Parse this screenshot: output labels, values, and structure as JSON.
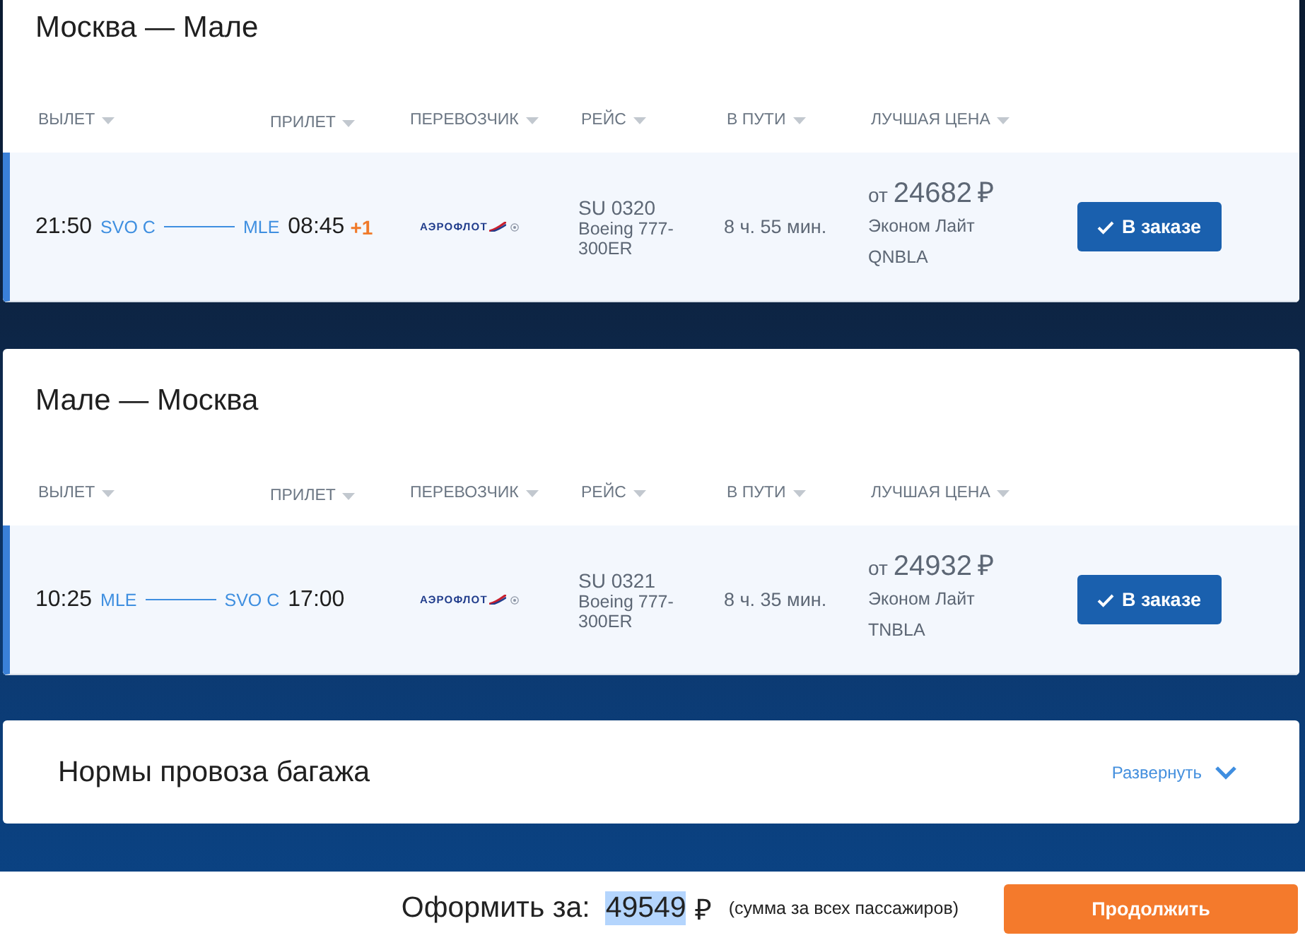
{
  "legs": [
    {
      "title": "Москва — Мале",
      "columns": [
        "ВЫЛЕТ",
        "ПРИЛЕТ",
        "ПЕРЕВОЗЧИК",
        "РЕЙС",
        "В ПУТИ",
        "ЛУЧШАЯ ЦЕНА"
      ],
      "flights": [
        {
          "selected": true,
          "departure_time": "21:50",
          "departure_airport": "SVO C",
          "arrival_airport": "MLE",
          "arrival_time": "08:45",
          "day_offset": "+1",
          "carrier_logo": "АЭРОФЛОТ",
          "flight_number": "SU 0320",
          "aircraft": "Boeing 777-300ER",
          "duration": "8 ч. 55 мин.",
          "price_prefix": "от",
          "price": "24682",
          "currency": "₽",
          "fare": "Эконом Лайт",
          "fare_code": "QNBLA",
          "button": "В заказе"
        }
      ]
    },
    {
      "title": "Мале — Москва",
      "columns": [
        "ВЫЛЕТ",
        "ПРИЛЕТ",
        "ПЕРЕВОЗЧИК",
        "РЕЙС",
        "В ПУТИ",
        "ЛУЧШАЯ ЦЕНА"
      ],
      "flights": [
        {
          "selected": true,
          "departure_time": "10:25",
          "departure_airport": "MLE",
          "arrival_airport": "SVO C",
          "arrival_time": "17:00",
          "carrier_logo": "АЭРОФЛОТ",
          "flight_number": "SU 0321",
          "aircraft": "Boeing 777-300ER",
          "duration": "8 ч. 35 мин.",
          "price_prefix": "от",
          "price": "24932",
          "currency": "₽",
          "fare": "Эконом Лайт",
          "fare_code": "TNBLA",
          "button": "В заказе"
        }
      ]
    }
  ],
  "baggage": {
    "title": "Нормы провоза багажа",
    "toggle": "Развернуть",
    "expanded": false
  },
  "checkout": {
    "label": "Оформить за:",
    "amount": "49549",
    "amount_highlighted": true,
    "currency": "₽",
    "note": "(сумма за всех пассажиров)",
    "button": "Продолжить"
  }
}
